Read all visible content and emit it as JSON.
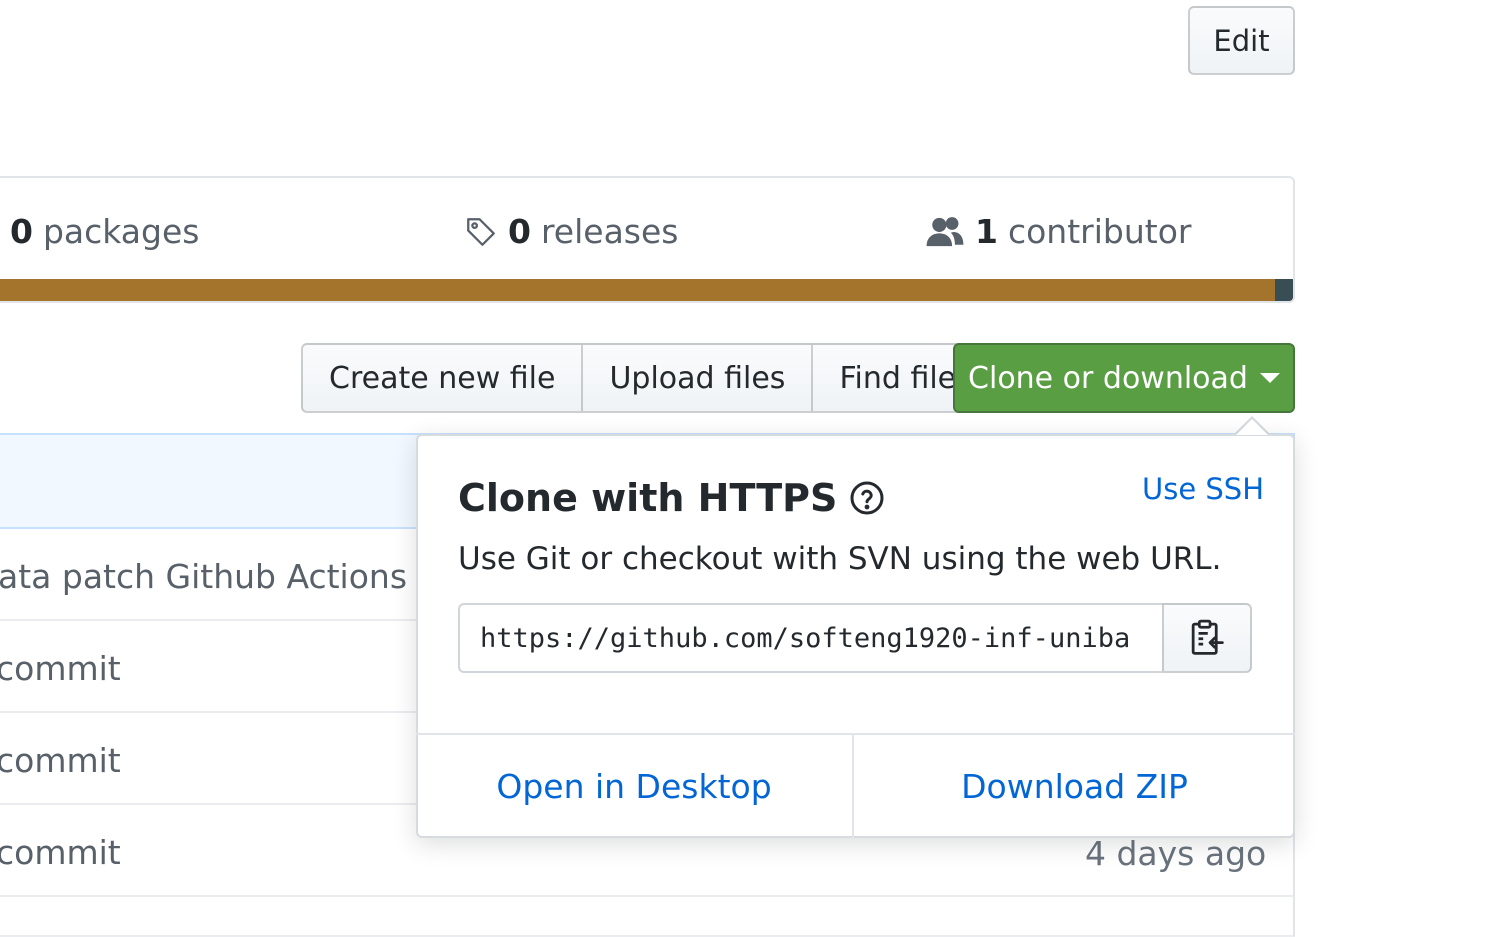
{
  "header": {
    "edit_label": "Edit"
  },
  "summary": {
    "packages": {
      "count": "0",
      "label": "packages"
    },
    "releases": {
      "count": "0",
      "label": "releases",
      "icon": "tag-icon"
    },
    "contributors": {
      "count": "1",
      "label": "contributor",
      "icon": "people-icon"
    },
    "language_bar_colors": [
      "#a5742c",
      "#384d54"
    ]
  },
  "file_nav": {
    "create_label": "Create new file",
    "upload_label": "Upload files",
    "find_label": "Find file",
    "clone_label": "Clone or download",
    "clone_color": "#5a9e44"
  },
  "files": {
    "rows": [
      {
        "message": "ata patch Github Actions"
      },
      {
        "message": "commit"
      },
      {
        "message": "commit"
      },
      {
        "message": "commit",
        "age": "4 days ago"
      }
    ]
  },
  "clone_dropdown": {
    "title": "Clone with HTTPS",
    "use_ssh_label": "Use SSH",
    "description": "Use Git or checkout with SVN using the web URL.",
    "url_value": "https://github.com/softeng1920-inf-uniba",
    "open_desktop_label": "Open in Desktop",
    "download_zip_label": "Download ZIP",
    "link_color": "#0366d6"
  }
}
